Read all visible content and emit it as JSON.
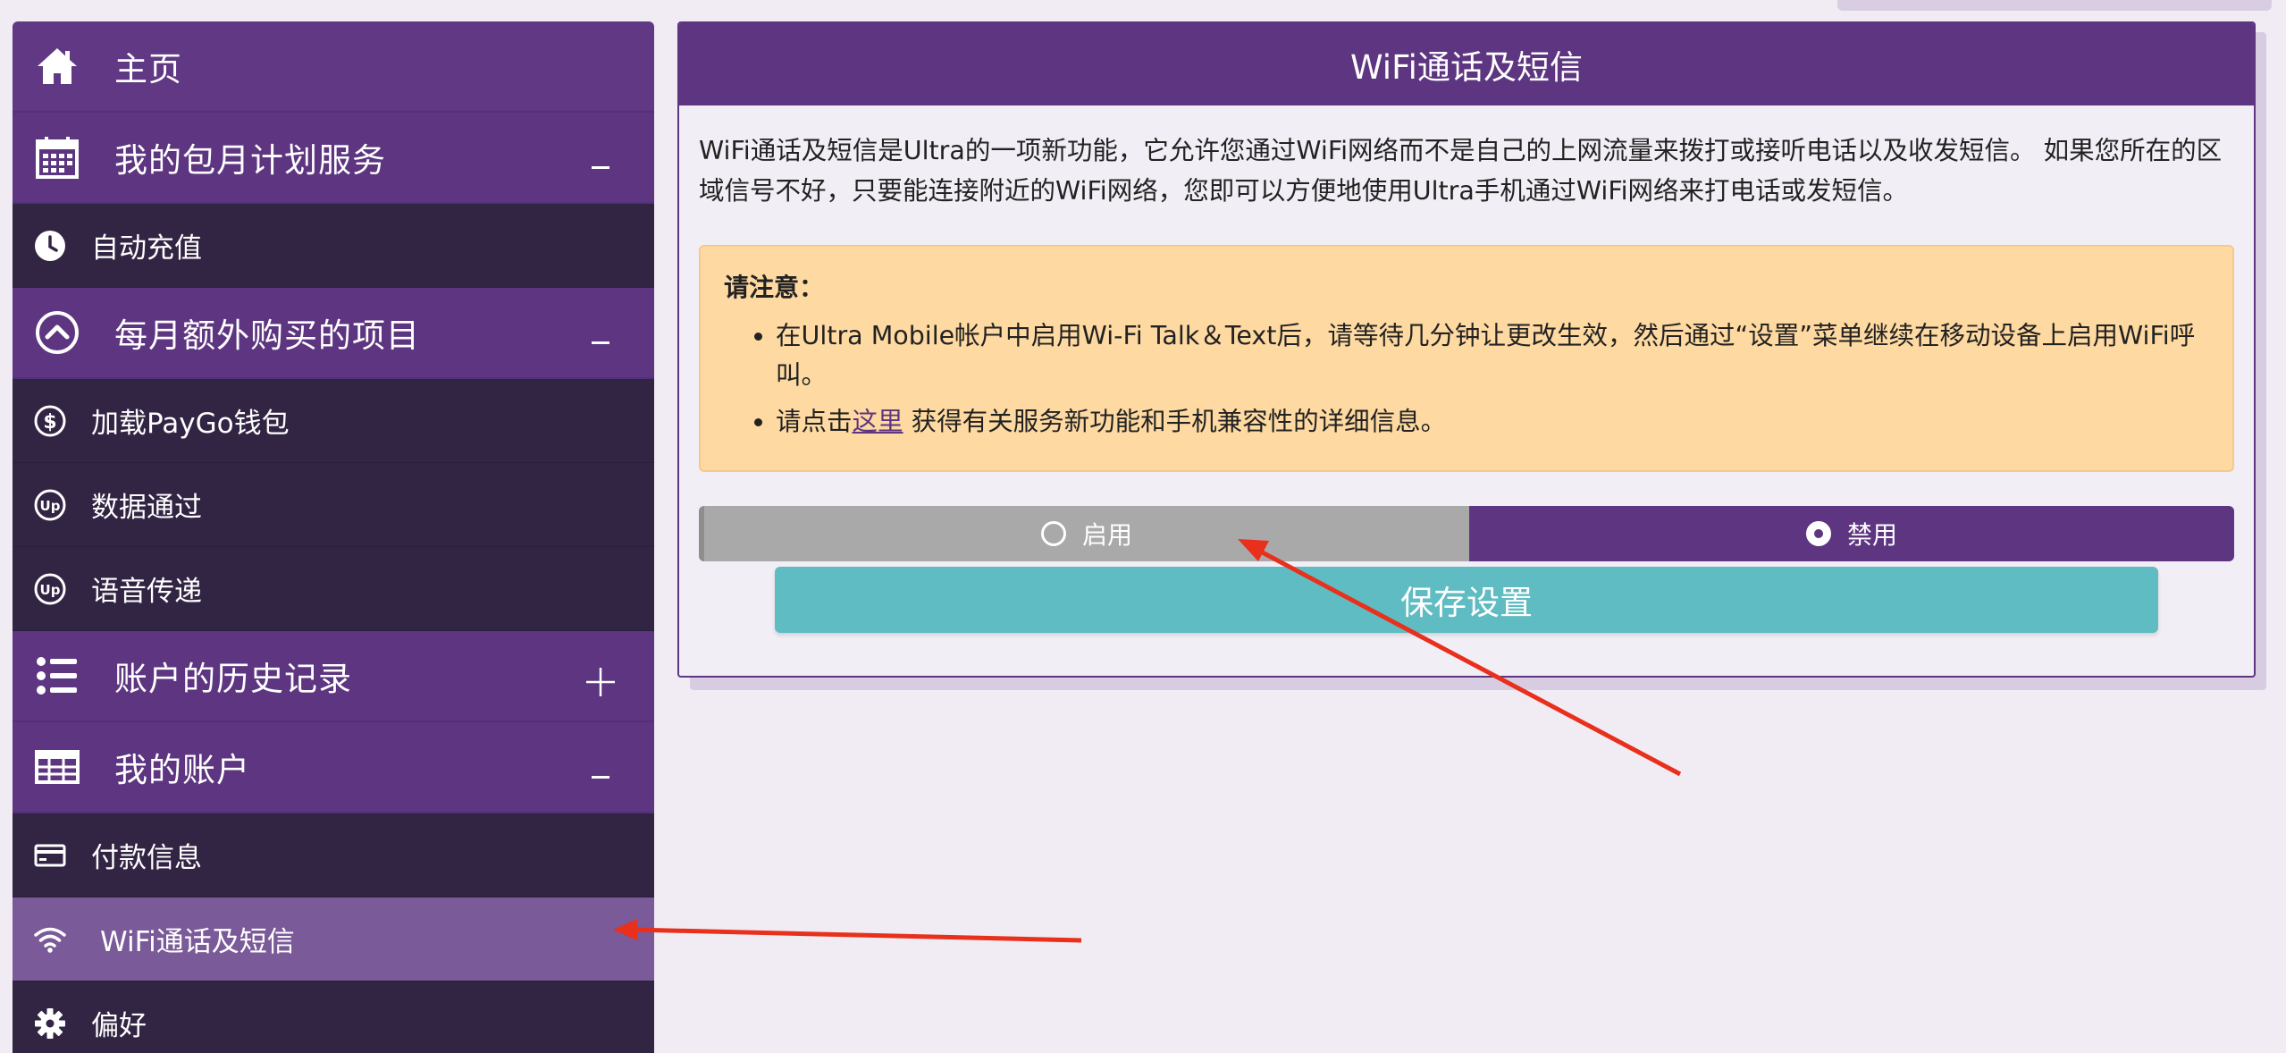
{
  "sidebar": {
    "home": "主页",
    "plan_services": {
      "label": "我的包月计划服务",
      "toggle": "−"
    },
    "auto_recharge": "自动充值",
    "monthly_extras": {
      "label": "每月额外购买的项目",
      "toggle": "−"
    },
    "paygo": "加载PayGo钱包",
    "data_pass": "数据通过",
    "voice_pass": "语音传递",
    "history": {
      "label": "账户的历史记录",
      "toggle": "+"
    },
    "my_account": {
      "label": "我的账户",
      "toggle": "−"
    },
    "payment_info": "付款信息",
    "wifi_talk": "WiFi通话及短信",
    "preferences": "偏好"
  },
  "panel": {
    "title": "WiFi通话及短信",
    "intro": "WiFi通话及短信是Ultra的一项新功能，它允许您通过WiFi网络而不是自己的上网流量来拨打或接听电话以及收发短信。 如果您所在的区域信号不好，只要能连接附近的WiFi网络，您即可以方便地使用Ultra手机通过WiFi网络来打电话或发短信。",
    "notice": {
      "title": "请注意：",
      "item1": "在Ultra Mobile帐户中启用Wi-Fi Talk＆Text后，请等待几分钟让更改生效，然后通过“设置”菜单继续在移动设备上启用WiFi呼叫。",
      "item2_pre": "请点击",
      "item2_link": "这里",
      "item2_post": " 获得有关服务新功能和手机兼容性的详细信息。"
    },
    "option_enable": "启用",
    "option_disable": "禁用",
    "selected": "禁用",
    "save_button": "保存设置"
  },
  "colors": {
    "brand_purple": "#5d3580",
    "sidebar_dark": "#322443",
    "active_item": "#7a5a98",
    "notice_bg": "#fed9a1",
    "save_teal": "#5fbcc2",
    "annotation_arrow": "#e8301c"
  }
}
